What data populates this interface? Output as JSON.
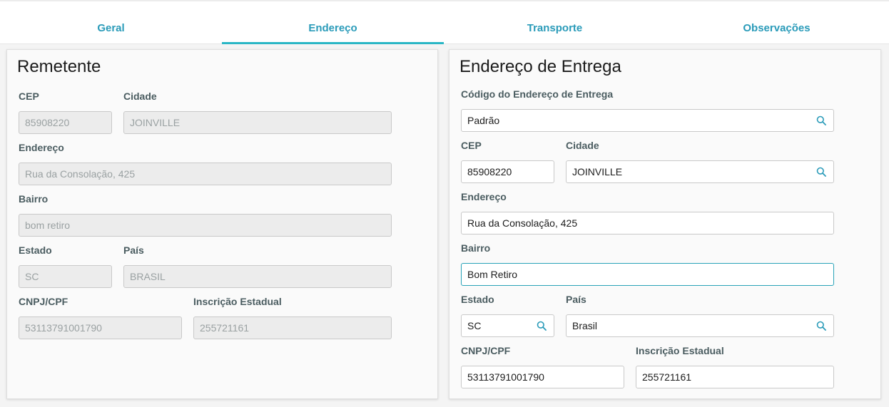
{
  "tabs": [
    {
      "label": "Geral"
    },
    {
      "label": "Endereço"
    },
    {
      "label": "Transporte"
    },
    {
      "label": "Observações"
    }
  ],
  "remetente": {
    "title": "Remetente",
    "cep": {
      "label": "CEP",
      "value": "85908220"
    },
    "cidade": {
      "label": "Cidade",
      "value": "JOINVILLE"
    },
    "endereco": {
      "label": "Endereço",
      "value": "Rua da Consolação, 425"
    },
    "bairro": {
      "label": "Bairro",
      "value": "bom retiro"
    },
    "estado": {
      "label": "Estado",
      "value": "SC"
    },
    "pais": {
      "label": "País",
      "value": "BRASIL"
    },
    "cnpj": {
      "label": "CNPJ/CPF",
      "value": "53113791001790"
    },
    "inscricao": {
      "label": "Inscrição Estadual",
      "value": "255721161"
    }
  },
  "entrega": {
    "title": "Endereço de Entrega",
    "codigo": {
      "label": "Código do Endereço de Entrega",
      "value": "Padrão"
    },
    "cep": {
      "label": "CEP",
      "value": "85908220"
    },
    "cidade": {
      "label": "Cidade",
      "value": "JOINVILLE"
    },
    "endereco": {
      "label": "Endereço",
      "value": "Rua da Consolação, 425"
    },
    "bairro": {
      "label": "Bairro",
      "value": "Bom Retiro"
    },
    "estado": {
      "label": "Estado",
      "value": "SC"
    },
    "pais": {
      "label": "País",
      "value": "Brasil"
    },
    "cnpj": {
      "label": "CNPJ/CPF",
      "value": "53113791001790"
    },
    "inscricao": {
      "label": "Inscrição Estadual",
      "value": "255721161"
    }
  },
  "colors": {
    "accent": "#29b6c5",
    "tab_text": "#2a9bb9"
  },
  "icons": {
    "lookup": "search-icon"
  }
}
